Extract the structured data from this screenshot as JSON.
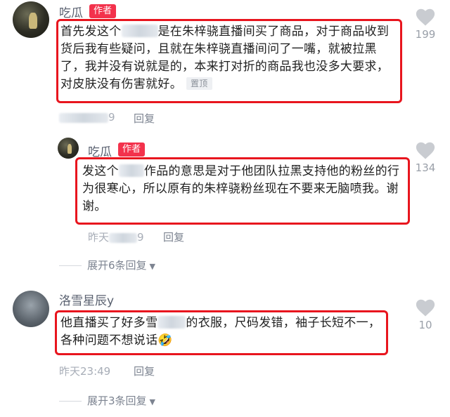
{
  "comments": [
    {
      "user": "吃瓜",
      "badge": "作者",
      "text_a": "首先发这个",
      "text_b": "是在朱梓骁直播间买了商品，对于商品收到货后我有些疑问，且就在朱梓骁直播间问了一嘴，就被拉黑了，我并没有说就是的，本来打对折的商品我也没多大要求，对皮肤没有伤害就好。",
      "pinned": "置顶",
      "time": "9",
      "reply": "回复",
      "likes": "199"
    },
    {
      "user": "吃瓜",
      "badge": "作者",
      "text_a": "发这个",
      "text_b": "作品的意思是对于他团队拉黑支持他的粉丝的行为很寒心，所以原有的朱梓骁粉丝现在不要来无脑喷我。谢谢。",
      "time_a": "昨天",
      "time_b": "9",
      "reply": "回复",
      "likes": "134"
    },
    {
      "user": "洛雪星辰y",
      "text_a": "他直播买了好多雪",
      "text_b": "的衣服，尺码发错，袖子长短不一，各种问题不想说话",
      "emoji": "🤣",
      "time": "昨天23:49",
      "reply": "回复",
      "likes": "10"
    }
  ],
  "expand_1": "展开6条回复",
  "expand_2": "展开3条回复",
  "colors": {
    "highlight_box": "#e8151e",
    "author_badge": "#f3324c"
  },
  "icons": {
    "like": "heart-icon",
    "expand": "caret-down-icon"
  }
}
